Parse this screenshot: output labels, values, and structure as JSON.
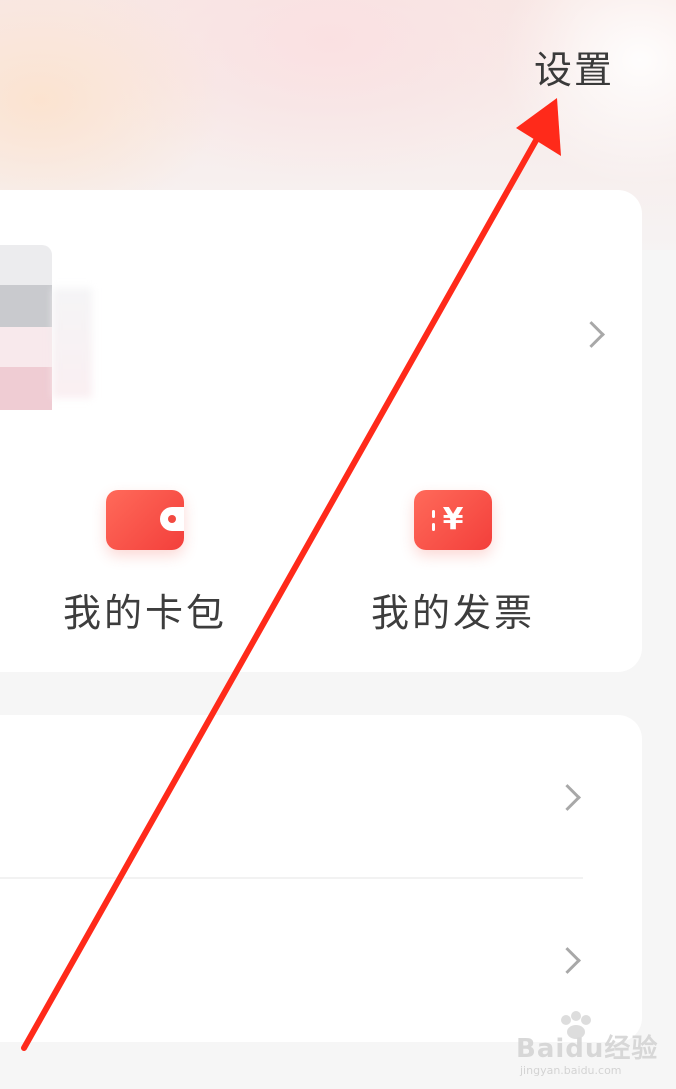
{
  "header": {
    "settings_label": "设置"
  },
  "shortcuts": [
    {
      "label": "我的卡包",
      "icon": "wallet-icon"
    },
    {
      "label": "我的发票",
      "icon": "invoice-yen-icon",
      "glyph": "¥"
    }
  ],
  "watermark": {
    "brand": "Bai",
    "brand_suffix": "du",
    "brand_cn": "经验",
    "site": "jingyan.baidu.com"
  },
  "colors": {
    "accent": "#f33f3b",
    "annotation_arrow": "#ff2a1a",
    "text_primary": "#3d3d3d",
    "chevron": "#a8a8a8"
  }
}
